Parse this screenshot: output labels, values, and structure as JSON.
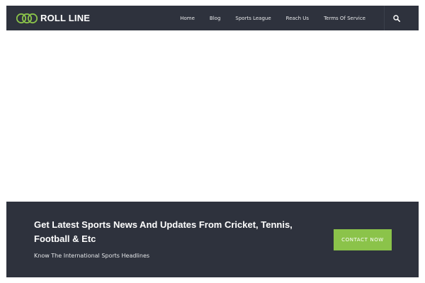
{
  "header": {
    "logo_text": "ROLL LINE",
    "logo_icon": "rings-logo-icon",
    "nav": [
      {
        "label": "Home"
      },
      {
        "label": "Blog"
      },
      {
        "label": "Sports League"
      },
      {
        "label": "Reach Us"
      },
      {
        "label": "Terms Of Service"
      }
    ],
    "search_icon": "search-icon"
  },
  "cta": {
    "heading": "Get Latest Sports News And Updates From Cricket, Tennis, Football & Etc",
    "subtext": "Know The International Sports Headlines",
    "button_label": "CONTACT NOW"
  },
  "colors": {
    "header_bg": "#2e323d",
    "accent": "#8bc34a",
    "text_light": "#ffffff"
  }
}
